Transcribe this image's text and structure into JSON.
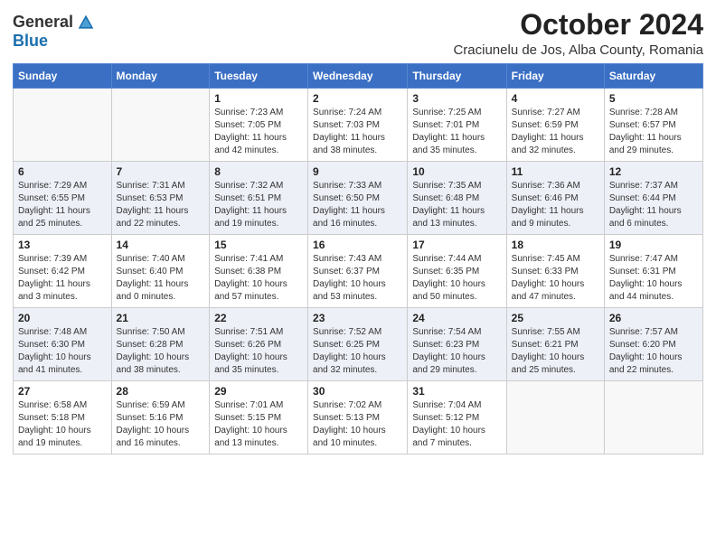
{
  "logo": {
    "general": "General",
    "blue": "Blue"
  },
  "title": {
    "month": "October 2024",
    "location": "Craciunelu de Jos, Alba County, Romania"
  },
  "days_of_week": [
    "Sunday",
    "Monday",
    "Tuesday",
    "Wednesday",
    "Thursday",
    "Friday",
    "Saturday"
  ],
  "weeks": [
    [
      {
        "day": "",
        "info": ""
      },
      {
        "day": "",
        "info": ""
      },
      {
        "day": "1",
        "info": "Sunrise: 7:23 AM\nSunset: 7:05 PM\nDaylight: 11 hours and 42 minutes."
      },
      {
        "day": "2",
        "info": "Sunrise: 7:24 AM\nSunset: 7:03 PM\nDaylight: 11 hours and 38 minutes."
      },
      {
        "day": "3",
        "info": "Sunrise: 7:25 AM\nSunset: 7:01 PM\nDaylight: 11 hours and 35 minutes."
      },
      {
        "day": "4",
        "info": "Sunrise: 7:27 AM\nSunset: 6:59 PM\nDaylight: 11 hours and 32 minutes."
      },
      {
        "day": "5",
        "info": "Sunrise: 7:28 AM\nSunset: 6:57 PM\nDaylight: 11 hours and 29 minutes."
      }
    ],
    [
      {
        "day": "6",
        "info": "Sunrise: 7:29 AM\nSunset: 6:55 PM\nDaylight: 11 hours and 25 minutes."
      },
      {
        "day": "7",
        "info": "Sunrise: 7:31 AM\nSunset: 6:53 PM\nDaylight: 11 hours and 22 minutes."
      },
      {
        "day": "8",
        "info": "Sunrise: 7:32 AM\nSunset: 6:51 PM\nDaylight: 11 hours and 19 minutes."
      },
      {
        "day": "9",
        "info": "Sunrise: 7:33 AM\nSunset: 6:50 PM\nDaylight: 11 hours and 16 minutes."
      },
      {
        "day": "10",
        "info": "Sunrise: 7:35 AM\nSunset: 6:48 PM\nDaylight: 11 hours and 13 minutes."
      },
      {
        "day": "11",
        "info": "Sunrise: 7:36 AM\nSunset: 6:46 PM\nDaylight: 11 hours and 9 minutes."
      },
      {
        "day": "12",
        "info": "Sunrise: 7:37 AM\nSunset: 6:44 PM\nDaylight: 11 hours and 6 minutes."
      }
    ],
    [
      {
        "day": "13",
        "info": "Sunrise: 7:39 AM\nSunset: 6:42 PM\nDaylight: 11 hours and 3 minutes."
      },
      {
        "day": "14",
        "info": "Sunrise: 7:40 AM\nSunset: 6:40 PM\nDaylight: 11 hours and 0 minutes."
      },
      {
        "day": "15",
        "info": "Sunrise: 7:41 AM\nSunset: 6:38 PM\nDaylight: 10 hours and 57 minutes."
      },
      {
        "day": "16",
        "info": "Sunrise: 7:43 AM\nSunset: 6:37 PM\nDaylight: 10 hours and 53 minutes."
      },
      {
        "day": "17",
        "info": "Sunrise: 7:44 AM\nSunset: 6:35 PM\nDaylight: 10 hours and 50 minutes."
      },
      {
        "day": "18",
        "info": "Sunrise: 7:45 AM\nSunset: 6:33 PM\nDaylight: 10 hours and 47 minutes."
      },
      {
        "day": "19",
        "info": "Sunrise: 7:47 AM\nSunset: 6:31 PM\nDaylight: 10 hours and 44 minutes."
      }
    ],
    [
      {
        "day": "20",
        "info": "Sunrise: 7:48 AM\nSunset: 6:30 PM\nDaylight: 10 hours and 41 minutes."
      },
      {
        "day": "21",
        "info": "Sunrise: 7:50 AM\nSunset: 6:28 PM\nDaylight: 10 hours and 38 minutes."
      },
      {
        "day": "22",
        "info": "Sunrise: 7:51 AM\nSunset: 6:26 PM\nDaylight: 10 hours and 35 minutes."
      },
      {
        "day": "23",
        "info": "Sunrise: 7:52 AM\nSunset: 6:25 PM\nDaylight: 10 hours and 32 minutes."
      },
      {
        "day": "24",
        "info": "Sunrise: 7:54 AM\nSunset: 6:23 PM\nDaylight: 10 hours and 29 minutes."
      },
      {
        "day": "25",
        "info": "Sunrise: 7:55 AM\nSunset: 6:21 PM\nDaylight: 10 hours and 25 minutes."
      },
      {
        "day": "26",
        "info": "Sunrise: 7:57 AM\nSunset: 6:20 PM\nDaylight: 10 hours and 22 minutes."
      }
    ],
    [
      {
        "day": "27",
        "info": "Sunrise: 6:58 AM\nSunset: 5:18 PM\nDaylight: 10 hours and 19 minutes."
      },
      {
        "day": "28",
        "info": "Sunrise: 6:59 AM\nSunset: 5:16 PM\nDaylight: 10 hours and 16 minutes."
      },
      {
        "day": "29",
        "info": "Sunrise: 7:01 AM\nSunset: 5:15 PM\nDaylight: 10 hours and 13 minutes."
      },
      {
        "day": "30",
        "info": "Sunrise: 7:02 AM\nSunset: 5:13 PM\nDaylight: 10 hours and 10 minutes."
      },
      {
        "day": "31",
        "info": "Sunrise: 7:04 AM\nSunset: 5:12 PM\nDaylight: 10 hours and 7 minutes."
      },
      {
        "day": "",
        "info": ""
      },
      {
        "day": "",
        "info": ""
      }
    ]
  ]
}
